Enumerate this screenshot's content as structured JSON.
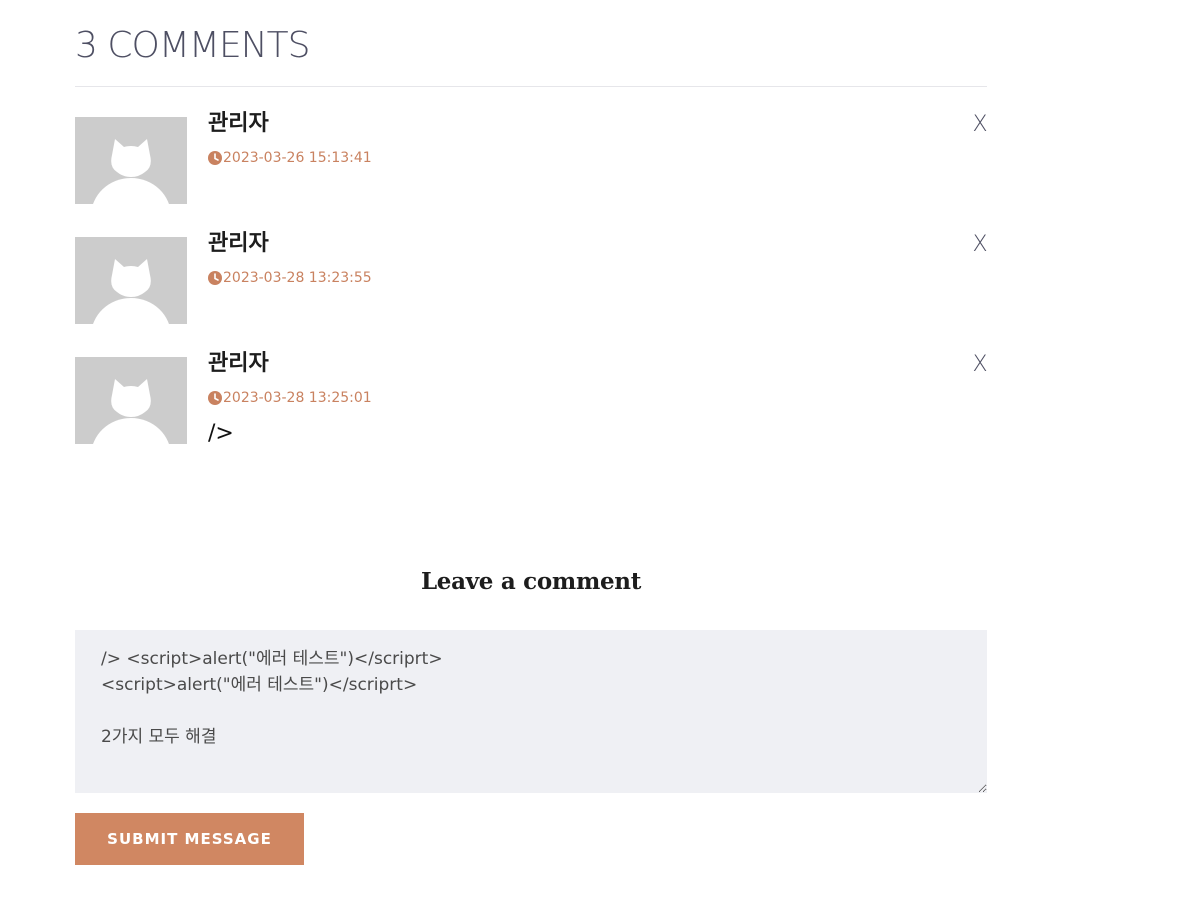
{
  "comments_header": {
    "title": "3 COMMENTS"
  },
  "comments": [
    {
      "author": "관리자",
      "date": "2023-03-26 15:13:41",
      "body": "",
      "delete_label": "X",
      "avatar_icon": "cat-user-avatar-icon",
      "date_icon": "clock-icon"
    },
    {
      "author": "관리자",
      "date": "2023-03-28 13:23:55",
      "body": "",
      "delete_label": "X",
      "avatar_icon": "cat-user-avatar-icon",
      "date_icon": "clock-icon"
    },
    {
      "author": "관리자",
      "date": "2023-03-28 13:25:01",
      "body": "/>",
      "delete_label": "X",
      "avatar_icon": "cat-user-avatar-icon",
      "date_icon": "clock-icon"
    }
  ],
  "comment_form": {
    "title": "Leave a comment",
    "textarea_value": "/> <script>alert(\"에러 테스트\")</scriprt>\n<script>alert(\"에러 테스트\")</scriprt>\n\n2가지 모두 해결",
    "submit_label": "SUBMIT MESSAGE"
  },
  "colors": {
    "title_text": "#4e4f63",
    "date_accent": "#c98260",
    "avatar_bg": "#cccccc",
    "textarea_bg": "#eff0f4",
    "submit_bg": "#d08762"
  }
}
